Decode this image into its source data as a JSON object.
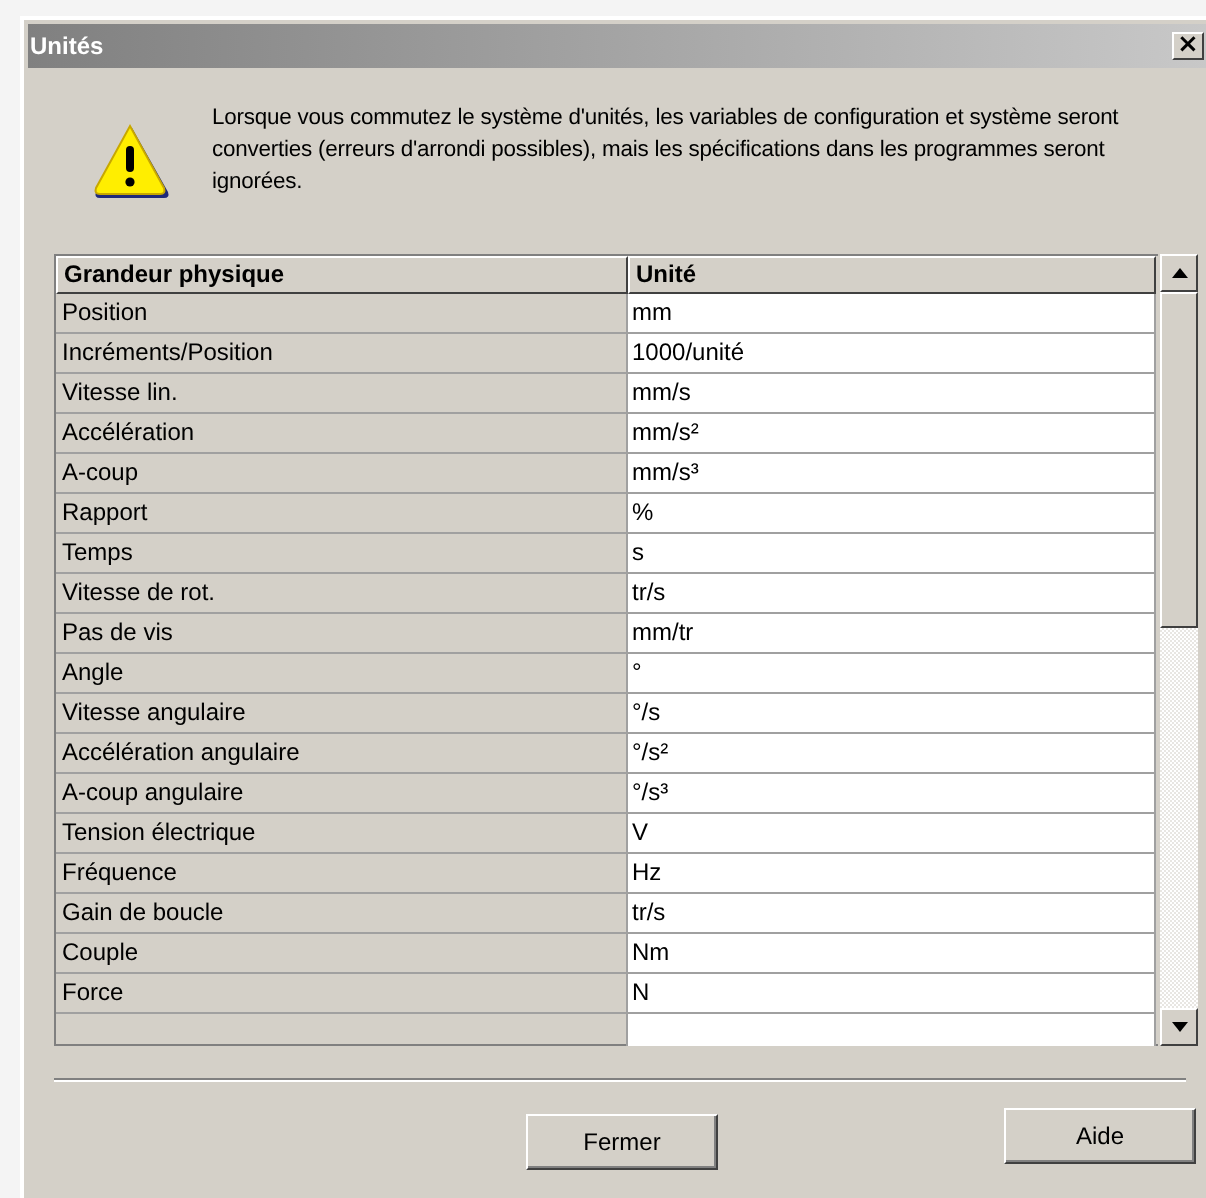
{
  "window": {
    "title": "Unités",
    "close": "×"
  },
  "message": "Lorsque vous commutez le système d'unités, les variables de configuration et système seront converties (erreurs d'arrondi possibles), mais les spécifications dans les programmes seront ignorées.",
  "table": {
    "columns": [
      "Grandeur physique",
      "Unité"
    ],
    "rows": [
      {
        "quantity": "Position",
        "unit": "mm"
      },
      {
        "quantity": "Incréments/Position",
        "unit": "1000/unité"
      },
      {
        "quantity": "Vitesse lin.",
        "unit": "mm/s"
      },
      {
        "quantity": "Accélération",
        "unit": "mm/s²"
      },
      {
        "quantity": "A-coup",
        "unit": "mm/s³"
      },
      {
        "quantity": "Rapport",
        "unit": "%"
      },
      {
        "quantity": "Temps",
        "unit": "s"
      },
      {
        "quantity": "Vitesse de rot.",
        "unit": "tr/s"
      },
      {
        "quantity": "Pas de vis",
        "unit": "mm/tr"
      },
      {
        "quantity": "Angle",
        "unit": "°"
      },
      {
        "quantity": "Vitesse angulaire",
        "unit": "°/s"
      },
      {
        "quantity": "Accélération angulaire",
        "unit": "°/s²"
      },
      {
        "quantity": "A-coup angulaire",
        "unit": "°/s³"
      },
      {
        "quantity": "Tension électrique",
        "unit": "V"
      },
      {
        "quantity": "Fréquence",
        "unit": "Hz"
      },
      {
        "quantity": "Gain de boucle",
        "unit": "tr/s"
      },
      {
        "quantity": "Couple",
        "unit": "Nm"
      },
      {
        "quantity": "Force",
        "unit": "N"
      }
    ]
  },
  "buttons": [
    {
      "label": "Fermer",
      "kind": "close"
    },
    {
      "label": "Aide",
      "kind": "help"
    }
  ]
}
